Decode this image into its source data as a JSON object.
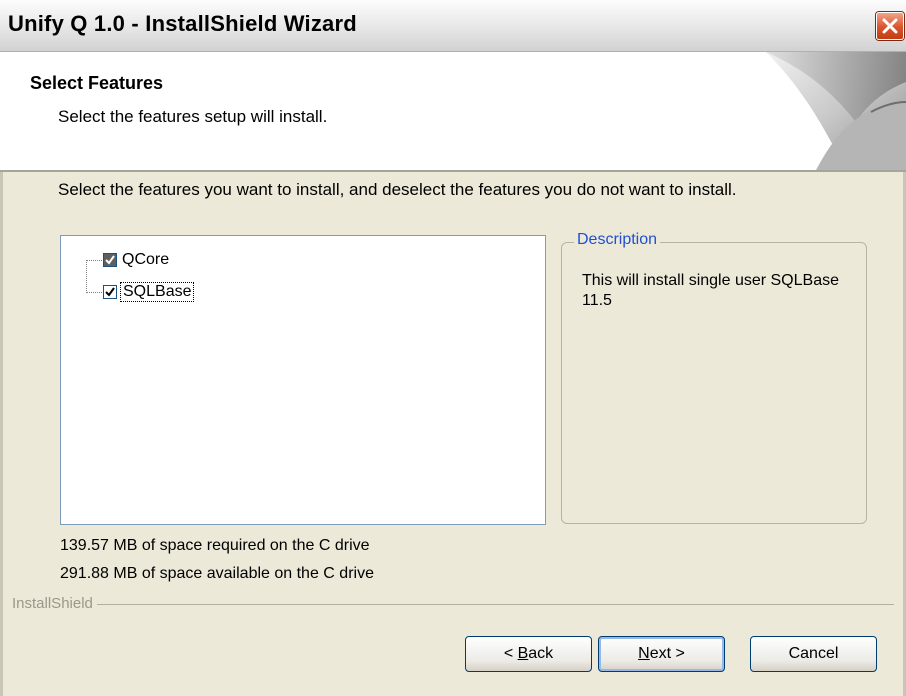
{
  "window": {
    "title": "Unify Q 1.0 - InstallShield Wizard"
  },
  "header": {
    "title": "Select Features",
    "subtitle": "Select the features setup will install."
  },
  "instructions": "Select the features you want to install, and deselect the features you do not want to install.",
  "tree": {
    "items": [
      {
        "label": "QCore",
        "state": "partial"
      },
      {
        "label": "SQLBase",
        "state": "checked"
      }
    ]
  },
  "description": {
    "legend": "Description",
    "text": "This will install single user SQLBase 11.5"
  },
  "space": {
    "required": "139.57 MB of space required on the C drive",
    "available": "291.88 MB of space available on the C drive"
  },
  "footer": {
    "brand": "InstallShield"
  },
  "buttons": {
    "back_prefix": "< ",
    "back_key": "B",
    "back_rest": "ack",
    "next_key": "N",
    "next_rest": "ext >",
    "cancel": "Cancel"
  },
  "colors": {
    "face": "#ECE9D8",
    "legend": "#1f4fd6",
    "close": "#d9542c"
  }
}
